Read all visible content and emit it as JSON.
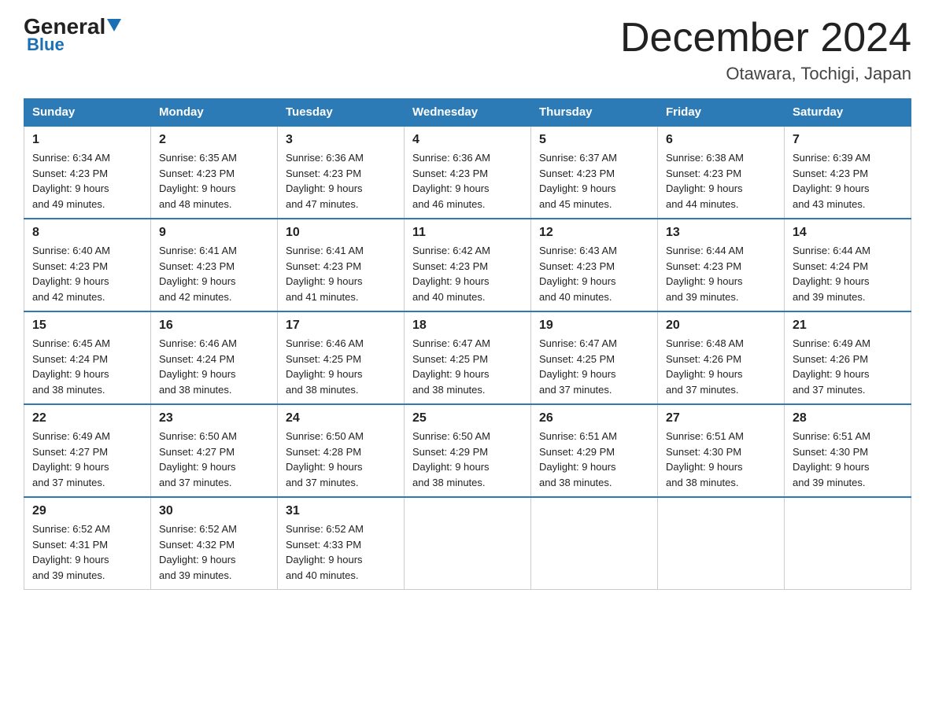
{
  "header": {
    "logo_general": "General",
    "logo_blue": "Blue",
    "month_title": "December 2024",
    "location": "Otawara, Tochigi, Japan"
  },
  "weekdays": [
    "Sunday",
    "Monday",
    "Tuesday",
    "Wednesday",
    "Thursday",
    "Friday",
    "Saturday"
  ],
  "weeks": [
    [
      {
        "day": "1",
        "sunrise": "6:34 AM",
        "sunset": "4:23 PM",
        "daylight": "9 hours and 49 minutes."
      },
      {
        "day": "2",
        "sunrise": "6:35 AM",
        "sunset": "4:23 PM",
        "daylight": "9 hours and 48 minutes."
      },
      {
        "day": "3",
        "sunrise": "6:36 AM",
        "sunset": "4:23 PM",
        "daylight": "9 hours and 47 minutes."
      },
      {
        "day": "4",
        "sunrise": "6:36 AM",
        "sunset": "4:23 PM",
        "daylight": "9 hours and 46 minutes."
      },
      {
        "day": "5",
        "sunrise": "6:37 AM",
        "sunset": "4:23 PM",
        "daylight": "9 hours and 45 minutes."
      },
      {
        "day": "6",
        "sunrise": "6:38 AM",
        "sunset": "4:23 PM",
        "daylight": "9 hours and 44 minutes."
      },
      {
        "day": "7",
        "sunrise": "6:39 AM",
        "sunset": "4:23 PM",
        "daylight": "9 hours and 43 minutes."
      }
    ],
    [
      {
        "day": "8",
        "sunrise": "6:40 AM",
        "sunset": "4:23 PM",
        "daylight": "9 hours and 42 minutes."
      },
      {
        "day": "9",
        "sunrise": "6:41 AM",
        "sunset": "4:23 PM",
        "daylight": "9 hours and 42 minutes."
      },
      {
        "day": "10",
        "sunrise": "6:41 AM",
        "sunset": "4:23 PM",
        "daylight": "9 hours and 41 minutes."
      },
      {
        "day": "11",
        "sunrise": "6:42 AM",
        "sunset": "4:23 PM",
        "daylight": "9 hours and 40 minutes."
      },
      {
        "day": "12",
        "sunrise": "6:43 AM",
        "sunset": "4:23 PM",
        "daylight": "9 hours and 40 minutes."
      },
      {
        "day": "13",
        "sunrise": "6:44 AM",
        "sunset": "4:23 PM",
        "daylight": "9 hours and 39 minutes."
      },
      {
        "day": "14",
        "sunrise": "6:44 AM",
        "sunset": "4:24 PM",
        "daylight": "9 hours and 39 minutes."
      }
    ],
    [
      {
        "day": "15",
        "sunrise": "6:45 AM",
        "sunset": "4:24 PM",
        "daylight": "9 hours and 38 minutes."
      },
      {
        "day": "16",
        "sunrise": "6:46 AM",
        "sunset": "4:24 PM",
        "daylight": "9 hours and 38 minutes."
      },
      {
        "day": "17",
        "sunrise": "6:46 AM",
        "sunset": "4:25 PM",
        "daylight": "9 hours and 38 minutes."
      },
      {
        "day": "18",
        "sunrise": "6:47 AM",
        "sunset": "4:25 PM",
        "daylight": "9 hours and 38 minutes."
      },
      {
        "day": "19",
        "sunrise": "6:47 AM",
        "sunset": "4:25 PM",
        "daylight": "9 hours and 37 minutes."
      },
      {
        "day": "20",
        "sunrise": "6:48 AM",
        "sunset": "4:26 PM",
        "daylight": "9 hours and 37 minutes."
      },
      {
        "day": "21",
        "sunrise": "6:49 AM",
        "sunset": "4:26 PM",
        "daylight": "9 hours and 37 minutes."
      }
    ],
    [
      {
        "day": "22",
        "sunrise": "6:49 AM",
        "sunset": "4:27 PM",
        "daylight": "9 hours and 37 minutes."
      },
      {
        "day": "23",
        "sunrise": "6:50 AM",
        "sunset": "4:27 PM",
        "daylight": "9 hours and 37 minutes."
      },
      {
        "day": "24",
        "sunrise": "6:50 AM",
        "sunset": "4:28 PM",
        "daylight": "9 hours and 37 minutes."
      },
      {
        "day": "25",
        "sunrise": "6:50 AM",
        "sunset": "4:29 PM",
        "daylight": "9 hours and 38 minutes."
      },
      {
        "day": "26",
        "sunrise": "6:51 AM",
        "sunset": "4:29 PM",
        "daylight": "9 hours and 38 minutes."
      },
      {
        "day": "27",
        "sunrise": "6:51 AM",
        "sunset": "4:30 PM",
        "daylight": "9 hours and 38 minutes."
      },
      {
        "day": "28",
        "sunrise": "6:51 AM",
        "sunset": "4:30 PM",
        "daylight": "9 hours and 39 minutes."
      }
    ],
    [
      {
        "day": "29",
        "sunrise": "6:52 AM",
        "sunset": "4:31 PM",
        "daylight": "9 hours and 39 minutes."
      },
      {
        "day": "30",
        "sunrise": "6:52 AM",
        "sunset": "4:32 PM",
        "daylight": "9 hours and 39 minutes."
      },
      {
        "day": "31",
        "sunrise": "6:52 AM",
        "sunset": "4:33 PM",
        "daylight": "9 hours and 40 minutes."
      },
      null,
      null,
      null,
      null
    ]
  ],
  "labels": {
    "sunrise": "Sunrise:",
    "sunset": "Sunset:",
    "daylight": "Daylight:"
  }
}
